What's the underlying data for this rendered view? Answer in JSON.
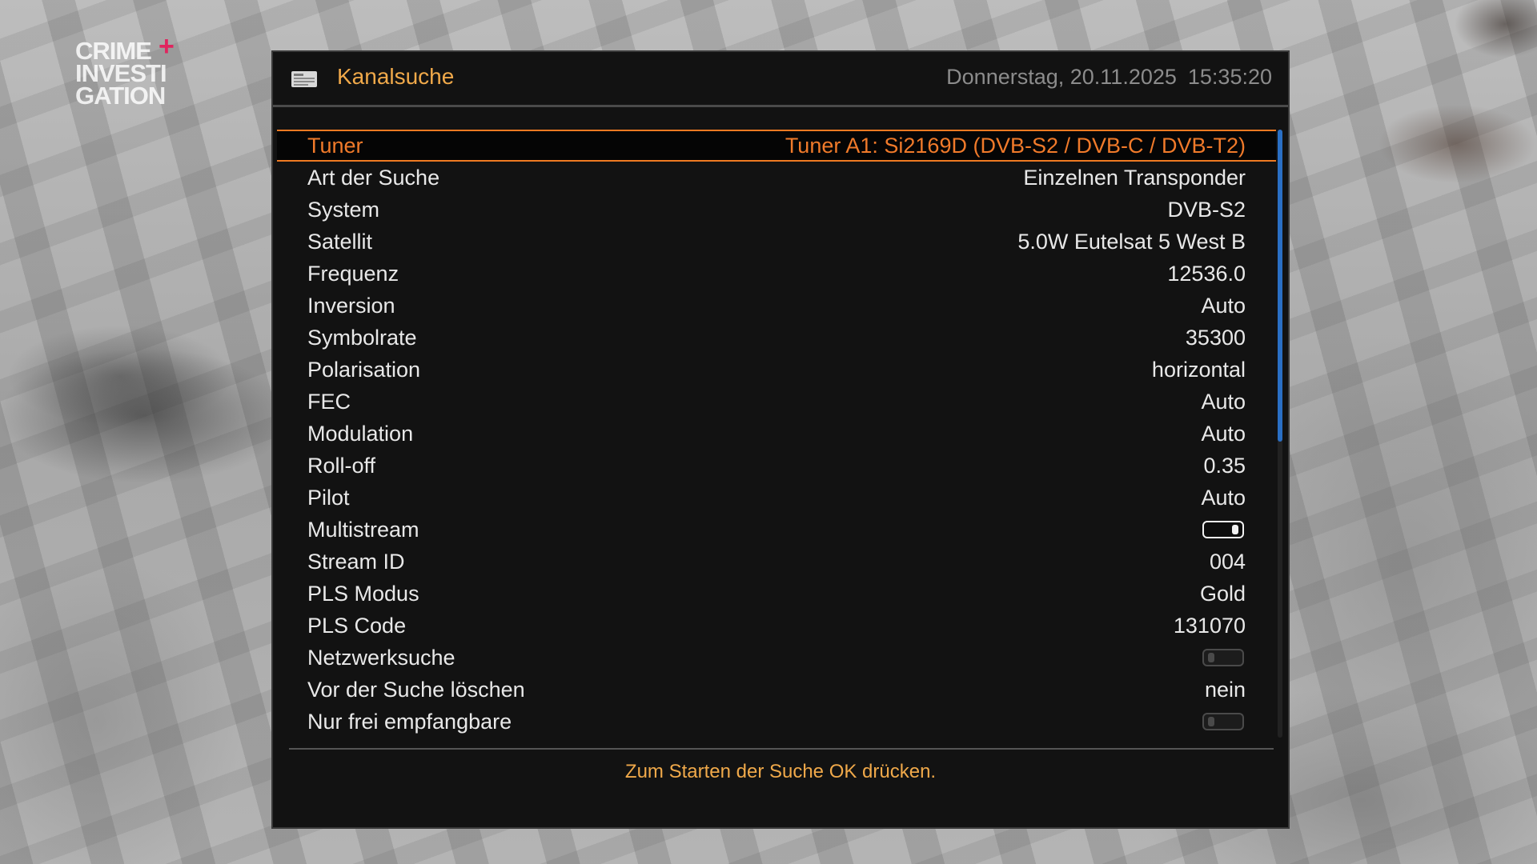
{
  "logo": {
    "lines": [
      "CRIME",
      "INVESTI",
      "GATION"
    ],
    "plus": "+"
  },
  "header": {
    "title": "Kanalsuche",
    "date": "Donnerstag, 20.11.2025",
    "time": "15:35:20",
    "icon": "tv-scan-icon"
  },
  "rows": [
    {
      "label": "Tuner",
      "value": "Tuner A1: Si2169D (DVB-S2 / DVB-C / DVB-T2)",
      "selected": true
    },
    {
      "label": "Art der Suche",
      "value": "Einzelnen Transponder"
    },
    {
      "label": "System",
      "value": "DVB-S2"
    },
    {
      "label": "Satellit",
      "value": "5.0W Eutelsat 5 West B"
    },
    {
      "label": "Frequenz",
      "value": "12536.0"
    },
    {
      "label": "Inversion",
      "value": "Auto"
    },
    {
      "label": "Symbolrate",
      "value": "35300"
    },
    {
      "label": "Polarisation",
      "value": "horizontal"
    },
    {
      "label": "FEC",
      "value": "Auto"
    },
    {
      "label": "Modulation",
      "value": "Auto"
    },
    {
      "label": "Roll-off",
      "value": "0.35"
    },
    {
      "label": "Pilot",
      "value": "Auto"
    },
    {
      "label": "Multistream",
      "toggle": true
    },
    {
      "label": "Stream ID",
      "value": "004"
    },
    {
      "label": "PLS Modus",
      "value": "Gold"
    },
    {
      "label": "PLS Code",
      "value": "131070"
    },
    {
      "label": "Netzwerksuche",
      "toggle": false
    },
    {
      "label": "Vor der Suche löschen",
      "value": "nein"
    },
    {
      "label": "Nur frei empfangbare",
      "toggle": false
    }
  ],
  "footer": {
    "hint": "Zum Starten der Suche OK drücken."
  },
  "colors": {
    "accent": "#f0a94a",
    "selection": "#ef7a22",
    "scrollbar": "#2a6fc4"
  }
}
